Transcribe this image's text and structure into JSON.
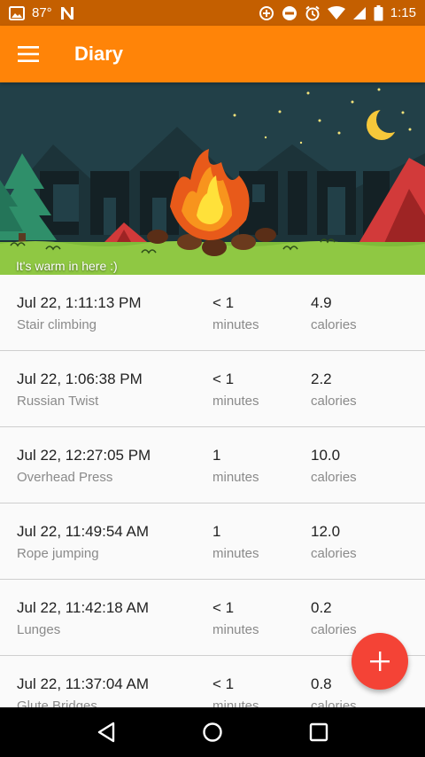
{
  "status_bar": {
    "temperature": "87°",
    "time": "1:15",
    "bg_color": "#c45f00",
    "icons_left": [
      "image-icon",
      "temperature-text",
      "news-icon"
    ],
    "icons_right": [
      "data-saver-icon",
      "do-not-disturb-icon",
      "alarm-icon",
      "wifi-icon",
      "signal-icon",
      "battery-icon"
    ]
  },
  "app_bar": {
    "title": "Diary",
    "color": "#ff8408",
    "menu_icon": "hamburger-menu-icon"
  },
  "banner": {
    "art_text": "CAMPING",
    "caption": "It's warm in here :)"
  },
  "entries": [
    {
      "datetime": "Jul 22, 1:11:13 PM",
      "activity": "Stair climbing",
      "duration": "< 1",
      "duration_unit": "minutes",
      "calories": "4.9",
      "calories_unit": "calories"
    },
    {
      "datetime": "Jul 22, 1:06:38 PM",
      "activity": "Russian Twist",
      "duration": "< 1",
      "duration_unit": "minutes",
      "calories": "2.2",
      "calories_unit": "calories"
    },
    {
      "datetime": "Jul 22, 12:27:05 PM",
      "activity": "Overhead Press",
      "duration": "1",
      "duration_unit": "minutes",
      "calories": "10.0",
      "calories_unit": "calories"
    },
    {
      "datetime": "Jul 22, 11:49:54 AM",
      "activity": "Rope jumping",
      "duration": "1",
      "duration_unit": "minutes",
      "calories": "12.0",
      "calories_unit": "calories"
    },
    {
      "datetime": "Jul 22, 11:42:18 AM",
      "activity": "Lunges",
      "duration": "< 1",
      "duration_unit": "minutes",
      "calories": "0.2",
      "calories_unit": "calories"
    },
    {
      "datetime": "Jul 22, 11:37:04 AM",
      "activity": "Glute Bridges",
      "duration": "< 1",
      "duration_unit": "minutes",
      "calories": "0.8",
      "calories_unit": "calories"
    }
  ],
  "fab": {
    "icon": "plus-icon",
    "color": "#f44336"
  },
  "nav_bar": {
    "icons": [
      "back-icon",
      "home-icon",
      "recents-icon"
    ]
  }
}
